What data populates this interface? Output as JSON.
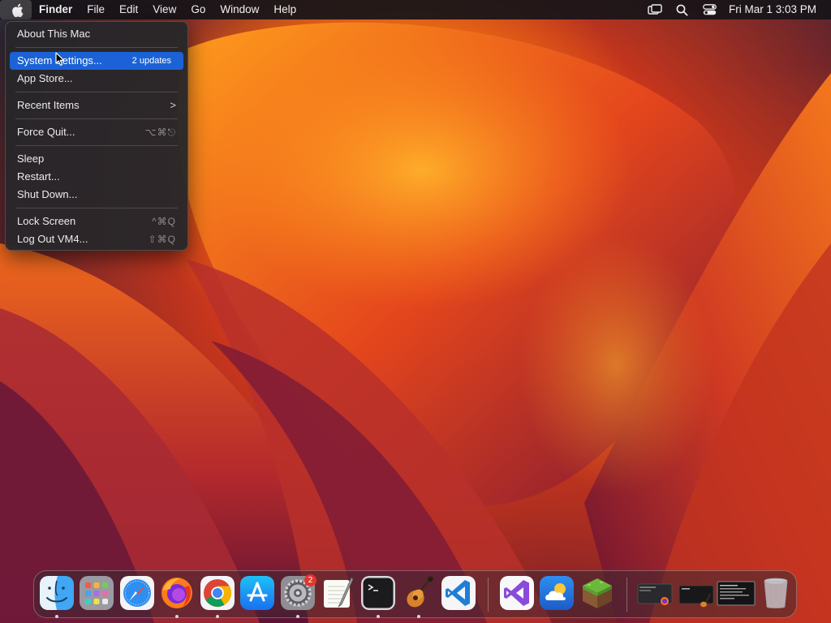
{
  "menubar": {
    "app_name": "Finder",
    "items": [
      "File",
      "Edit",
      "View",
      "Go",
      "Window",
      "Help"
    ],
    "clock": "Fri Mar 1  3:03 PM",
    "status_icons": [
      "screen-mirroring-icon",
      "spotlight-search-icon",
      "control-center-icon"
    ]
  },
  "apple_menu": {
    "about": "About This Mac",
    "system_settings": "System Settings...",
    "system_settings_badge": "2 updates",
    "app_store": "App Store...",
    "recent_items": "Recent Items",
    "recent_items_arrow": ">",
    "force_quit": "Force Quit...",
    "force_quit_shortcut": "⌥⌘⎋",
    "sleep": "Sleep",
    "restart": "Restart...",
    "shut_down": "Shut Down...",
    "lock_screen": "Lock Screen",
    "lock_screen_shortcut": "^⌘Q",
    "log_out": "Log Out VM4...",
    "log_out_shortcut": "⇧⌘Q"
  },
  "dock": {
    "items": [
      {
        "name": "finder",
        "running": true
      },
      {
        "name": "launchpad",
        "running": false
      },
      {
        "name": "safari",
        "running": false
      },
      {
        "name": "firefox",
        "running": true
      },
      {
        "name": "chrome",
        "running": true
      },
      {
        "name": "app-store",
        "running": false
      },
      {
        "name": "system-settings",
        "running": true,
        "badge": "2"
      },
      {
        "name": "textedit",
        "running": false
      },
      {
        "name": "terminal",
        "running": true
      },
      {
        "name": "garageband",
        "running": true
      },
      {
        "name": "vscode",
        "running": false
      },
      {
        "name": "visual-studio",
        "running": false
      },
      {
        "name": "weather",
        "running": false
      },
      {
        "name": "minecraft",
        "running": false
      },
      {
        "name": "window-thumbnail-1",
        "running": false
      },
      {
        "name": "window-thumbnail-2",
        "running": false
      },
      {
        "name": "window-thumbnail-3",
        "running": false
      },
      {
        "name": "trash",
        "running": false
      }
    ]
  },
  "colors": {
    "menu_highlight": "#1b62d6",
    "badge_red": "#e5352b"
  }
}
